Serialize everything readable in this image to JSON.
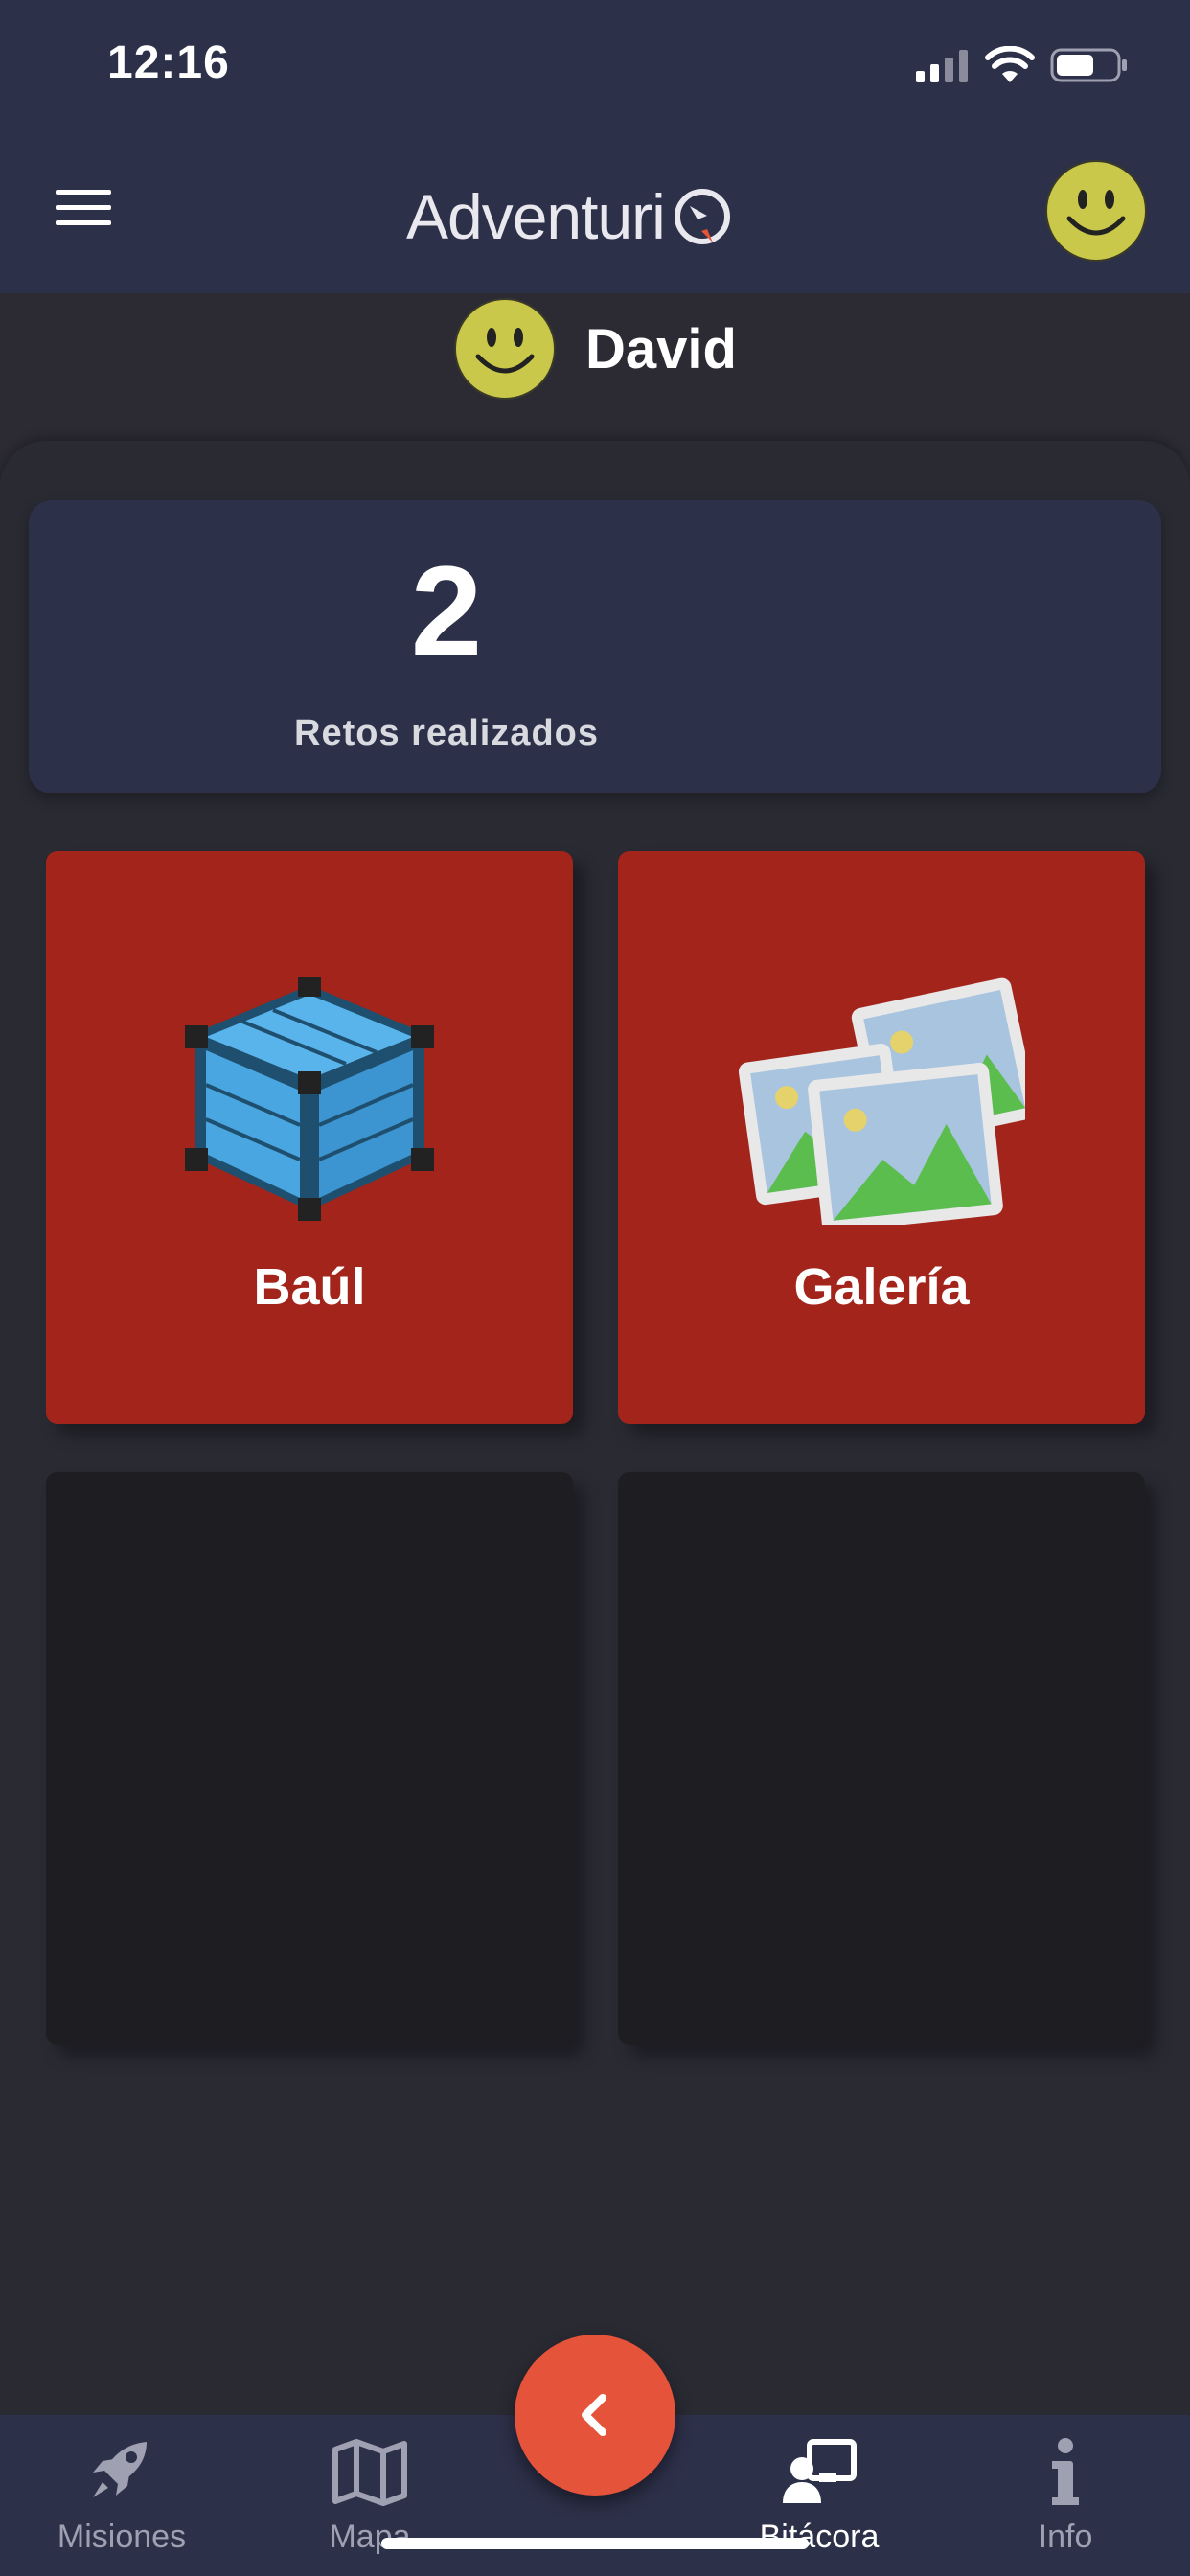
{
  "status_bar": {
    "time": "12:16"
  },
  "header": {
    "logo_text": "Adventuri"
  },
  "profile": {
    "name": "David"
  },
  "stats": {
    "value": "2",
    "label": "Retos realizados"
  },
  "tiles": [
    {
      "label": "Baúl",
      "icon": "chest-icon"
    },
    {
      "label": "Galería",
      "icon": "gallery-icon"
    }
  ],
  "nav": [
    {
      "label": "Misiones",
      "icon": "rocket-icon"
    },
    {
      "label": "Mapa",
      "icon": "map-icon"
    },
    {
      "label": "Bitácora",
      "icon": "logbook-icon",
      "active": true
    },
    {
      "label": "Info",
      "icon": "info-icon"
    }
  ],
  "colors": {
    "header": "#2d3049",
    "tile": "#a3241a",
    "fab": "#e5533a",
    "background": "#2c2b34"
  }
}
